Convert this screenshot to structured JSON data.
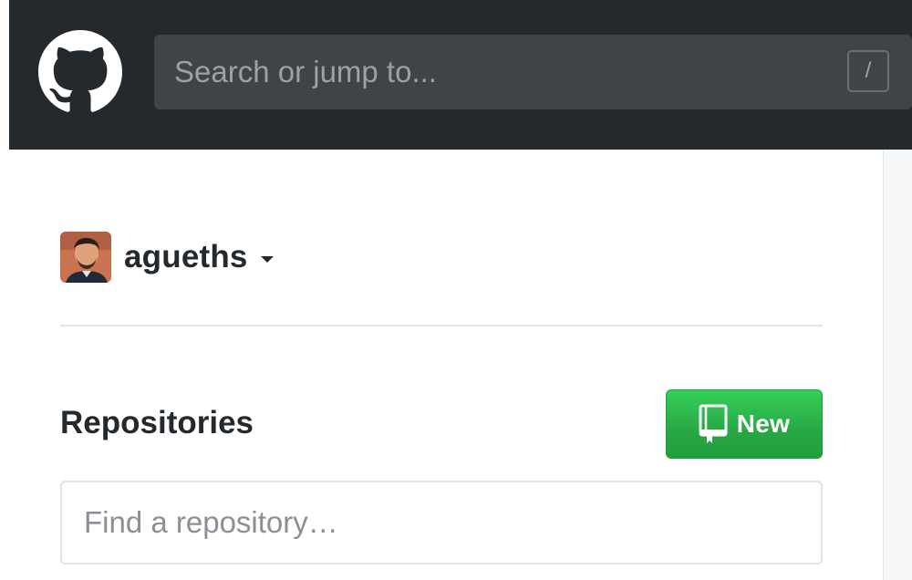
{
  "header": {
    "logo_icon": "github-octocat-icon",
    "search": {
      "placeholder": "Search or jump to...",
      "shortcut_key": "/"
    }
  },
  "sidebar": {
    "user": {
      "username": "agueths",
      "avatar_icon": "user-avatar",
      "dropdown_icon": "caret-down-icon"
    },
    "repositories": {
      "heading": "Repositories",
      "new_button_label": "New",
      "new_button_icon": "repo-icon",
      "find_placeholder": "Find a repository…"
    }
  },
  "colors": {
    "header_bg": "#24292e",
    "search_bg": "#3f4448",
    "new_button_green": "#28a745",
    "text_dark": "#24292e",
    "divider": "#e1e4e8"
  }
}
